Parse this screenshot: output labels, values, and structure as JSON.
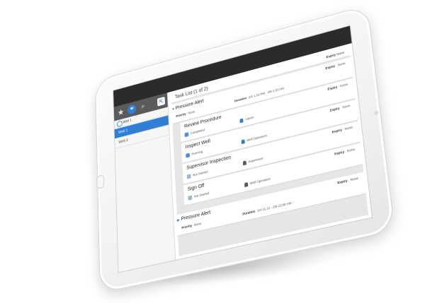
{
  "sidebar": {
    "sub_label": "Well 1",
    "items": [
      {
        "label": "Well 1",
        "active": true
      },
      {
        "label": "Well 2",
        "active": false
      }
    ]
  },
  "icons": [
    "star-icon",
    "share-icon",
    "search-icon",
    "pin-icon"
  ],
  "accent_color": "#2f7fd9",
  "task_list": {
    "title": "Task List (1 of 2)",
    "header_expiry_label": "Expiry",
    "header_expiry_value": "None",
    "tasks": [
      {
        "title": "Pressure Alert",
        "priority_label": "Priority",
        "priority_value": "None",
        "duration_label": "Duration",
        "duration_value": "2/4 1:23 PM - 4/5 1:23 AM",
        "expiry_label": "Expiry",
        "expiry_value": "None",
        "subtasks": [
          {
            "title": "Review Procedure",
            "status": "Completed",
            "assignee": "Admin",
            "expiry_label": "Expiry",
            "expiry_value": "None"
          },
          {
            "title": "Inspect Well",
            "status": "Running",
            "assignee": "Well Operators",
            "expiry_label": "Expiry",
            "expiry_value": "None"
          },
          {
            "title": "Supervisor Inspection",
            "status": "Not Started",
            "assignee": "Supervisor",
            "expiry_label": "Expiry",
            "expiry_value": "None"
          },
          {
            "title": "Sign Off",
            "status": "Not Started",
            "assignee": "Well Operators",
            "expiry_label": "Expiry",
            "expiry_value": "None"
          }
        ]
      },
      {
        "title": "Pressure Alert",
        "priority_label": "Priority",
        "priority_value": "None",
        "duration_label": "Duration",
        "duration_value": "2/4 11:11 - 2/9 12:00 AM",
        "expiry_label": "Expiry",
        "expiry_value": "None"
      }
    ]
  }
}
